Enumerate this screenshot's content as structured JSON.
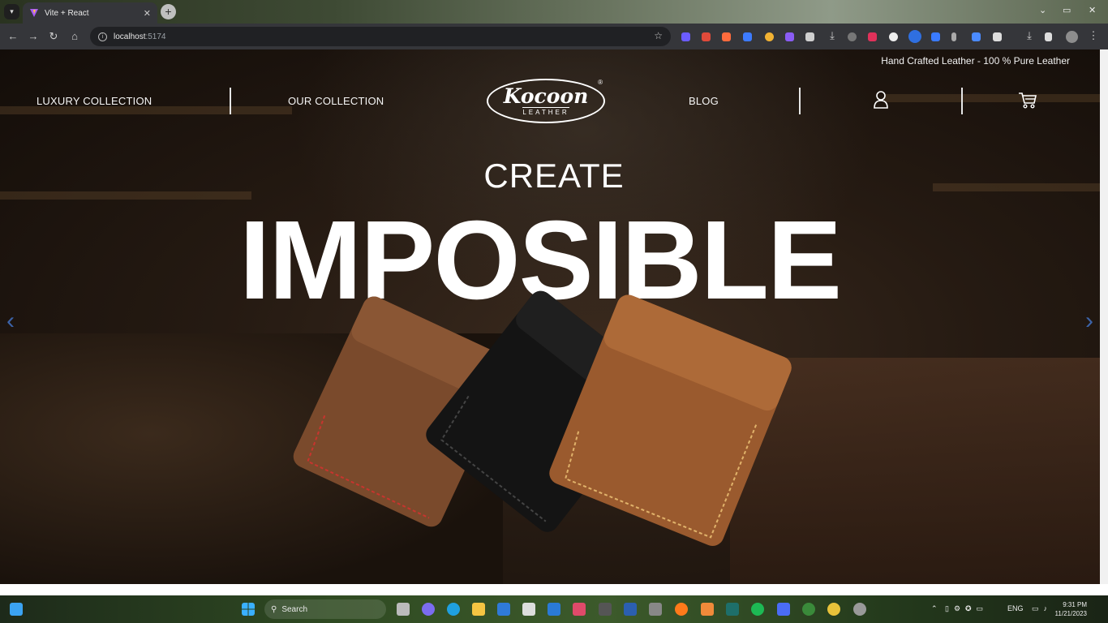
{
  "browser": {
    "tab_title": "Vite + React",
    "tab_close": "✕",
    "new_tab": "+",
    "url_host": "localhost",
    "url_port": ":5174",
    "window_controls": [
      "⌄",
      "▭",
      "✕"
    ]
  },
  "site": {
    "tagline": "Hand Crafted Leather - 100 % Pure Leather",
    "nav": {
      "luxury": "LUXURY COLLECTION",
      "our": "OUR COLLECTION",
      "blog": "BLOG"
    },
    "logo": {
      "brand": "Kocoon",
      "sub": "LEATHER",
      "reg": "®"
    },
    "hero": {
      "line1": "CREATE",
      "line2": "IMPOSIBLE"
    },
    "carousel": {
      "prev": "‹",
      "next": "›"
    },
    "wallet_colors": [
      "#7a4a2c",
      "#141414",
      "#9a5a2e"
    ]
  },
  "taskbar": {
    "search_placeholder": "Search",
    "lang": "ENG",
    "time": "9:31 PM",
    "date": "11/21/2023"
  }
}
